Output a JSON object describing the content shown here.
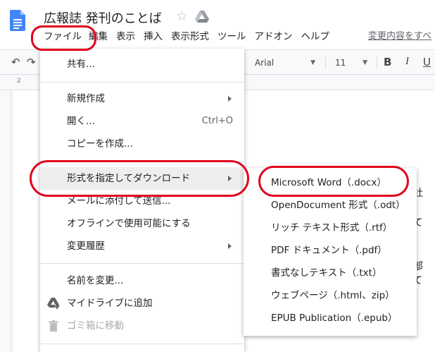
{
  "document": {
    "title": "広報誌 発刊のことば"
  },
  "menubar": {
    "items": [
      "ファイル",
      "編集",
      "表示",
      "挿入",
      "表示形式",
      "ツール",
      "アドオン",
      "ヘルプ"
    ],
    "last_edit": "変更内容をすべ"
  },
  "toolbar": {
    "font": "Arial",
    "font_size": "11",
    "bold": "B",
    "italic": "I",
    "underline": "U"
  },
  "ruler": {
    "mark": "2"
  },
  "page_text": [
    "い社",
    "いて",
    "ち、",
    "て、",
    "全部",
    "えて"
  ],
  "file_menu": {
    "share": "共有...",
    "new": "新規作成",
    "open": "開く...",
    "open_shortcut": "Ctrl+O",
    "copy": "コピーを作成...",
    "download": "形式を指定してダウンロード",
    "email": "メールに添付して送信...",
    "offline": "オフラインで使用可能にする",
    "history": "変更履歴",
    "rename": "名前を変更...",
    "add_to_drive": "マイドライブに追加",
    "trash": "ゴミ箱に移動"
  },
  "download_submenu": {
    "items": [
      "Microsoft Word（.docx）",
      "OpenDocument 形式（.odt）",
      "リッチ テキスト形式（.rtf）",
      "PDF ドキュメント（.pdf）",
      "書式なしテキスト（.txt）",
      "ウェブページ（.html、zip）",
      "EPUB Publication（.epub）"
    ]
  },
  "colors": {
    "annotation": "#e0001b",
    "docs_blue": "#4285f4",
    "highlight": "#eeeeee"
  },
  "icons": {
    "doc": "google-docs-icon",
    "star": "star-icon",
    "drive": "drive-icon",
    "undo": "undo-icon",
    "trash": "trash-icon"
  }
}
